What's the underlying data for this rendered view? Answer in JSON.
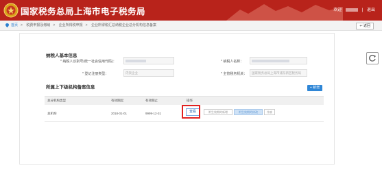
{
  "header": {
    "title": "国家税务总局上海市电子税务局",
    "welcome": "欢迎",
    "divider": "|",
    "logout": "退出"
  },
  "breadcrumb": {
    "items": [
      "首页",
      "税费申报及缴纳",
      "企业所得税申报",
      "企业所得税汇总纳税企业总分机构信息备案"
    ],
    "back_label": "返回"
  },
  "basic_info": {
    "section_title": "纳税人基本信息",
    "fields": [
      {
        "label": "* 纳税人识别号(统一社会信用代码)：",
        "value": ""
      },
      {
        "label": "* 纳税人名称：",
        "value": ""
      },
      {
        "label": "* 登记注册类型：",
        "value": "内资企业"
      },
      {
        "label": "* 主管税务机关：",
        "value": "国家税务总局上海市浦东新区税务局"
      }
    ]
  },
  "branch_section": {
    "title": "所属上下级机构备案信息",
    "add_label": "+ 新增",
    "columns": [
      "总分机构类型",
      "有效期起",
      "有效期止",
      "操作"
    ],
    "rows": [
      {
        "type": "总机构",
        "start": "2018-01-01",
        "end": "9999-12-31",
        "actions": [
          "查看",
          "附生效期的新增",
          "附生效期的修改",
          "作废"
        ]
      }
    ]
  },
  "colors": {
    "header_bg": "#b8231b",
    "accent_blue": "#2f86d6",
    "highlight_red": "#e12020"
  }
}
